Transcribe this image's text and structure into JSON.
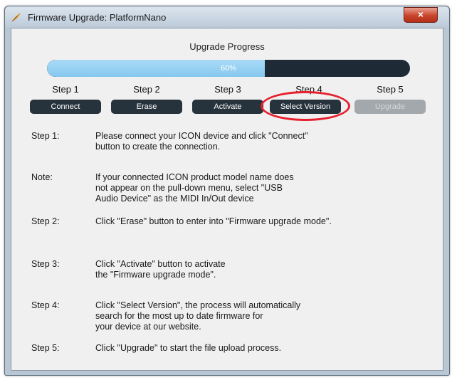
{
  "window": {
    "title": "Firmware Upgrade: PlatformNano",
    "close_label": "×"
  },
  "progress": {
    "label": "Upgrade Progress",
    "value_text": "60%",
    "value": 0.6
  },
  "steps": [
    {
      "label": "Step 1",
      "button": "Connect",
      "enabled": true
    },
    {
      "label": "Step 2",
      "button": "Erase",
      "enabled": true
    },
    {
      "label": "Step 3",
      "button": "Activate",
      "enabled": true
    },
    {
      "label": "Step 4",
      "button": "Select Version",
      "enabled": true
    },
    {
      "label": "Step 5",
      "button": "Upgrade",
      "enabled": false
    }
  ],
  "instructions": [
    {
      "key": "Step 1:",
      "lines": [
        "Please connect your ICON device and click \"Connect\"",
        "button to create the connection."
      ]
    },
    {
      "key": "Note:",
      "lines": [
        "If your connected ICON product model name does",
        "not appear on the pull-down menu, select \"USB",
        "Audio Device\" as the MIDI In/Out device"
      ]
    },
    {
      "key": "Step 2:",
      "lines": [
        "Click \"Erase\" button to enter into \"Firmware upgrade mode\"."
      ]
    },
    {
      "key": "Step 3:",
      "lines": [
        "Click \"Activate\" button to activate",
        "the \"Firmware upgrade mode\"."
      ]
    },
    {
      "key": "Step 4:",
      "lines": [
        "Click \"Select Version\", the process will automatically",
        "search for the most up to date firmware for",
        "your device at our website."
      ]
    },
    {
      "key": "Step 5:",
      "lines": [
        "Click \"Upgrade\" to start the file upload process."
      ]
    }
  ],
  "colors": {
    "highlight": "#e6202e",
    "progress_fill": "#86c8ef",
    "button_dark": "#26323c"
  }
}
